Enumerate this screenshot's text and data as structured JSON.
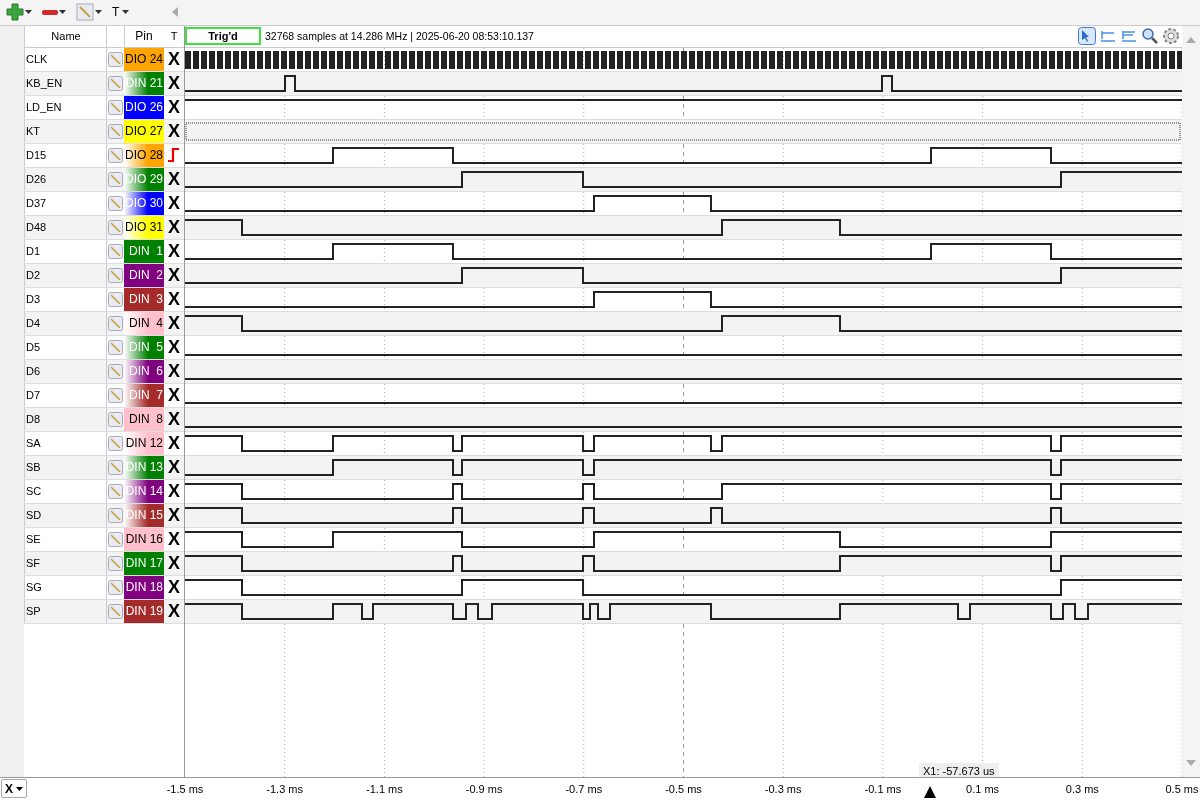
{
  "toolbar": {
    "text_tool": "T"
  },
  "header": {
    "name": "Name",
    "pin": "Pin",
    "trigger": "T",
    "status": "Trig'd",
    "info": "32768 samples at 14.286 MHz | 2025-06-20 08:53:10.137"
  },
  "channels": [
    {
      "name": "CLK",
      "pin": "DIO 24",
      "color": "#ffa500",
      "faded": false,
      "trigger": {
        "kind": "ignore",
        "label": "X"
      }
    },
    {
      "name": "KB_EN",
      "pin": "DIN 21",
      "color": "#008000",
      "faded": true,
      "trigger": {
        "kind": "ignore",
        "label": "X"
      }
    },
    {
      "name": "LD_EN",
      "pin": "DIO 26",
      "color": "#0000ff",
      "faded": false,
      "trigger": {
        "kind": "ignore",
        "label": "X"
      }
    },
    {
      "name": "KT",
      "pin": "DIO 27",
      "color": "#ffff00",
      "faded": false,
      "trigger": {
        "kind": "ignore",
        "label": "X"
      }
    },
    {
      "name": "D15",
      "pin": "DIO 28",
      "color": "#ffa500",
      "faded": true,
      "trigger": {
        "kind": "rising"
      }
    },
    {
      "name": "D26",
      "pin": "DIO 29",
      "color": "#008000",
      "faded": true,
      "trigger": {
        "kind": "ignore",
        "label": "X"
      }
    },
    {
      "name": "D37",
      "pin": "DIO 30",
      "color": "#0000ff",
      "faded": true,
      "trigger": {
        "kind": "ignore",
        "label": "X"
      }
    },
    {
      "name": "D48",
      "pin": "DIO 31",
      "color": "#ffff00",
      "faded": true,
      "trigger": {
        "kind": "ignore",
        "label": "X"
      }
    },
    {
      "name": "D1",
      "pin": "DIN  1",
      "color": "#008000",
      "faded": false,
      "trigger": {
        "kind": "ignore",
        "label": "X"
      }
    },
    {
      "name": "D2",
      "pin": "DIN  2",
      "color": "#800080",
      "faded": false,
      "trigger": {
        "kind": "ignore",
        "label": "X"
      }
    },
    {
      "name": "D3",
      "pin": "DIN  3",
      "color": "#a52a2a",
      "faded": false,
      "trigger": {
        "kind": "ignore",
        "label": "X"
      }
    },
    {
      "name": "D4",
      "pin": "DIN  4",
      "color": "#ffc0cb",
      "faded": true,
      "trigger": {
        "kind": "ignore",
        "label": "X"
      }
    },
    {
      "name": "D5",
      "pin": "DIN  5",
      "color": "#008000",
      "faded": true,
      "trigger": {
        "kind": "ignore",
        "label": "X"
      }
    },
    {
      "name": "D6",
      "pin": "DIN  6",
      "color": "#800080",
      "faded": true,
      "trigger": {
        "kind": "ignore",
        "label": "X"
      }
    },
    {
      "name": "D7",
      "pin": "DIN  7",
      "color": "#a52a2a",
      "faded": true,
      "trigger": {
        "kind": "ignore",
        "label": "X"
      }
    },
    {
      "name": "D8",
      "pin": "DIN  8",
      "color": "#ffc0cb",
      "faded": false,
      "trigger": {
        "kind": "ignore",
        "label": "X"
      }
    },
    {
      "name": "SA",
      "pin": "DIN 12",
      "color": "#ffc0cb",
      "faded": true,
      "trigger": {
        "kind": "ignore",
        "label": "X"
      }
    },
    {
      "name": "SB",
      "pin": "DIN 13",
      "color": "#008000",
      "faded": true,
      "trigger": {
        "kind": "ignore",
        "label": "X"
      }
    },
    {
      "name": "SC",
      "pin": "DIN 14",
      "color": "#800080",
      "faded": true,
      "trigger": {
        "kind": "ignore",
        "label": "X"
      }
    },
    {
      "name": "SD",
      "pin": "DIN 15",
      "color": "#a52a2a",
      "faded": true,
      "trigger": {
        "kind": "ignore",
        "label": "X"
      }
    },
    {
      "name": "SE",
      "pin": "DIN 16",
      "color": "#ffc0cb",
      "faded": false,
      "trigger": {
        "kind": "ignore",
        "label": "X"
      }
    },
    {
      "name": "SF",
      "pin": "DIN 17",
      "color": "#008000",
      "faded": false,
      "trigger": {
        "kind": "ignore",
        "label": "X"
      }
    },
    {
      "name": "SG",
      "pin": "DIN 18",
      "color": "#800080",
      "faded": false,
      "trigger": {
        "kind": "ignore",
        "label": "X"
      }
    },
    {
      "name": "SP",
      "pin": "DIN 19",
      "color": "#a52a2a",
      "faded": false,
      "trigger": {
        "kind": "ignore",
        "label": "X"
      }
    }
  ],
  "axis": {
    "unit_button": "X",
    "ticks": [
      "-1.5 ms",
      "-1.3 ms",
      "-1.1 ms",
      "-0.9 ms",
      "-0.7 ms",
      "-0.5 ms",
      "-0.3 ms",
      "-0.1 ms",
      "0.1 ms",
      "0.3 ms",
      "0.5 ms"
    ],
    "cursor": "X1: -57.673 us"
  }
}
